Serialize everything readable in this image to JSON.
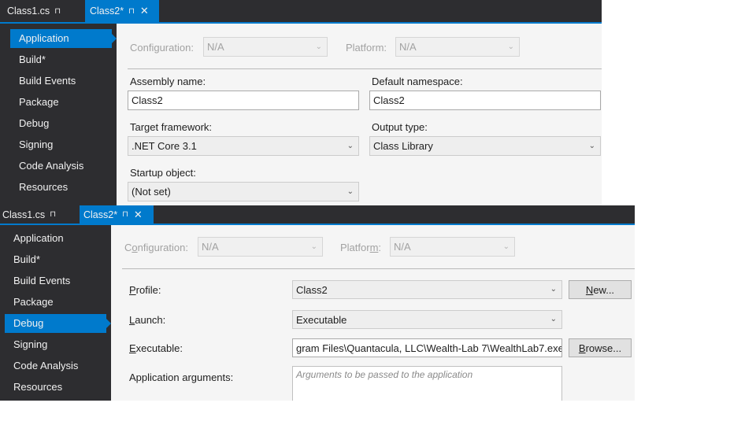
{
  "panel_top": {
    "tabs": [
      {
        "label": "Class1.cs",
        "pin": "⊓",
        "active": false
      },
      {
        "label": "Class2*",
        "pin": "⊓",
        "close": "✕",
        "active": true
      }
    ],
    "nav": [
      "Application",
      "Build*",
      "Build Events",
      "Package",
      "Debug",
      "Signing",
      "Code Analysis",
      "Resources"
    ],
    "selected_nav": "Application",
    "configuration": {
      "label": "Configuration:",
      "value": "N/A"
    },
    "platform": {
      "label": "Platform:",
      "value": "N/A"
    },
    "assembly_name": {
      "label": "Assembly name:",
      "value": "Class2"
    },
    "default_namespace": {
      "label": "Default namespace:",
      "value": "Class2"
    },
    "target_framework": {
      "label": "Target framework:",
      "value": ".NET Core 3.1"
    },
    "output_type": {
      "label": "Output type:",
      "value": "Class Library"
    },
    "startup_object": {
      "label": "Startup object:",
      "value": "(Not set)"
    }
  },
  "panel_bottom": {
    "tabs": [
      {
        "label": "Class1.cs",
        "pin": "⊓",
        "active": false
      },
      {
        "label": "Class2*",
        "pin": "⊓",
        "close": "✕",
        "active": true
      }
    ],
    "nav": [
      "Application",
      "Build*",
      "Build Events",
      "Package",
      "Debug",
      "Signing",
      "Code Analysis",
      "Resources"
    ],
    "selected_nav": "Debug",
    "configuration": {
      "label_pre": "C",
      "label_u": "o",
      "label_post": "nfiguration:",
      "value": "N/A"
    },
    "platform": {
      "label_pre": "Platfor",
      "label_u": "m",
      "label_post": ":",
      "value": "N/A"
    },
    "profile": {
      "label_pre": "",
      "label_u": "P",
      "label_post": "rofile:",
      "value": "Class2"
    },
    "new_button": {
      "label_pre": "",
      "label_u": "N",
      "label_post": "ew..."
    },
    "launch": {
      "label_pre": "",
      "label_u": "L",
      "label_post": "aunch:",
      "value": "Executable"
    },
    "executable": {
      "label_pre": "",
      "label_u": "E",
      "label_post": "xecutable:",
      "value": "gram Files\\Quantacula, LLC\\Wealth-Lab 7\\WealthLab7.exe"
    },
    "browse_button": {
      "label_pre": "",
      "label_u": "B",
      "label_post": "rowse..."
    },
    "application_arguments": {
      "label_pre": "Application ar",
      "label_u": "g",
      "label_post": "uments:",
      "placeholder": "Arguments to be passed to the application"
    }
  },
  "colors": {
    "accent": "#007acc",
    "dark": "#2d2d30",
    "content": "#f5f5f5"
  }
}
